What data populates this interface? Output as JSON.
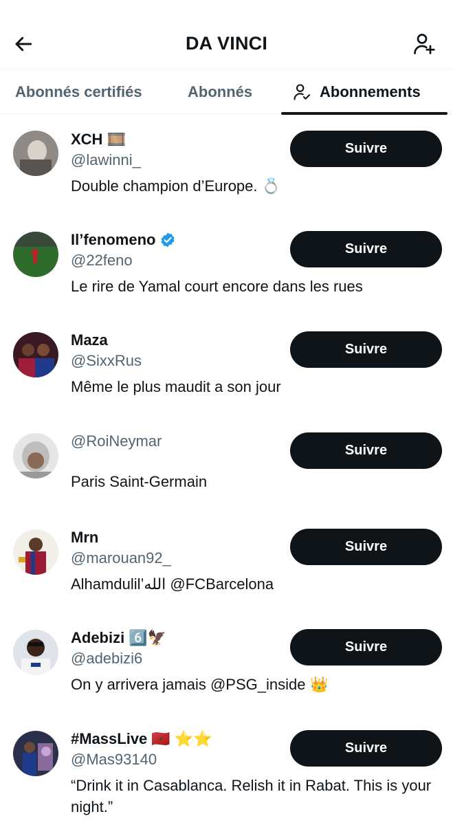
{
  "header": {
    "title": "DA VINCI"
  },
  "tabs": [
    {
      "label": "Abonnés certifiés"
    },
    {
      "label": "Abonnés"
    },
    {
      "label": "Abonnements"
    }
  ],
  "follow_label": "Suivre",
  "users": [
    {
      "name": "XCH",
      "name_emoji": "🎞️",
      "handle": "@lawinni_",
      "bio": "Double champion d’Europe. 💍",
      "verified": false
    },
    {
      "name": "Il’fenomeno",
      "name_emoji": "",
      "handle": "@22feno",
      "bio": "Le rire de Yamal court encore dans les rues",
      "verified": true
    },
    {
      "name": "Maza",
      "name_emoji": "",
      "handle": "@SixxRus",
      "bio": "Même le plus maudit a son jour",
      "verified": false
    },
    {
      "name": "",
      "name_emoji": "",
      "handle": "@RoiNeymar",
      "bio": "Paris Saint-Germain",
      "verified": false
    },
    {
      "name": "Mrn",
      "name_emoji": "",
      "handle": "@marouan92_",
      "bio": "Alhamdulil’الله @FCBarcelona",
      "verified": false
    },
    {
      "name": "Adebizi",
      "name_emoji": "6️⃣🦅",
      "handle": "@adebizi6",
      "bio": "On y arrivera jamais @PSG_inside 👑",
      "verified": false
    },
    {
      "name": "#MassLive",
      "name_emoji": "🇲🇦 ⭐⭐",
      "handle": "@Mas93140",
      "bio": "“Drink it in Casablanca. Relish it in Rabat. This is your night.”",
      "verified": false
    }
  ],
  "colors": {
    "text": "#0f1419",
    "secondary": "#536471",
    "verified": "#1d9bf0",
    "button": "#0f1419",
    "divider": "#eff3f4"
  }
}
